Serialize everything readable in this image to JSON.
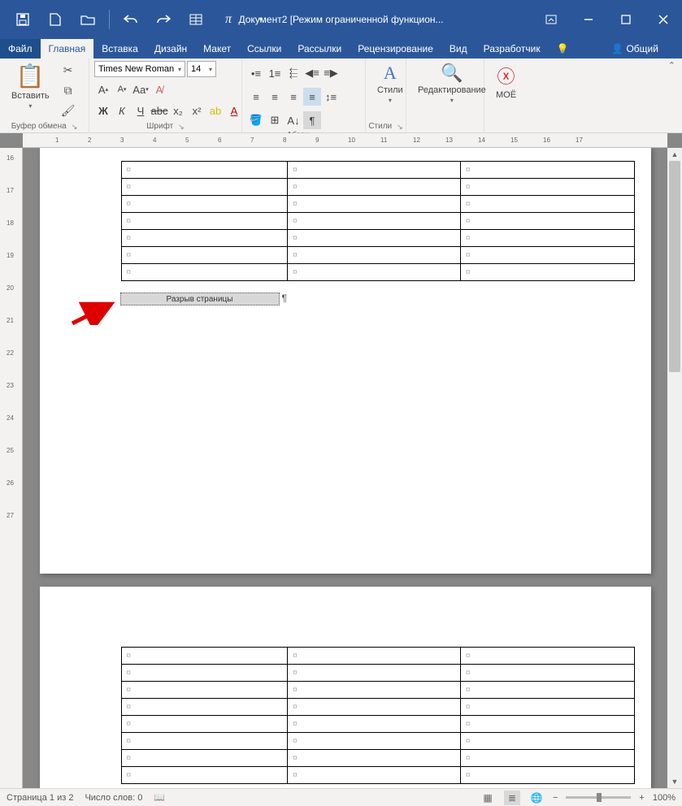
{
  "title": "Документ2 [Режим ограниченной функцион...",
  "qat": {
    "save": "save",
    "new": "new",
    "open": "open",
    "undo": "undo",
    "redo": "redo",
    "table": "table",
    "pi": "π",
    "tri": "▾"
  },
  "win": {
    "box": "box",
    "min": "—",
    "max": "❐",
    "close": "✕"
  },
  "tabs": {
    "file": "Файл",
    "home": "Главная",
    "insert": "Вставка",
    "design": "Дизайн",
    "layout": "Макет",
    "references": "Ссылки",
    "mailings": "Рассылки",
    "review": "Рецензирование",
    "view": "Вид",
    "developer": "Разработчик",
    "help": "Помощ",
    "share": "Общий доступ"
  },
  "ribbon": {
    "clipboard": {
      "paste": "Вставить",
      "label": "Буфер обмена"
    },
    "font": {
      "name": "Times New Roman",
      "size": "14",
      "label": "Шрифт",
      "bold": "Ж",
      "italic": "К",
      "underline": "Ч"
    },
    "paragraph": {
      "label": "Абзац"
    },
    "styles": {
      "btn": "Стили",
      "label": "Стили"
    },
    "editing": {
      "btn": "Редактирование"
    },
    "moe": {
      "btn": "МОЁ"
    }
  },
  "ruler_h": [
    1,
    2,
    3,
    4,
    5,
    6,
    7,
    8,
    9,
    10,
    11,
    12,
    13,
    14,
    15,
    16,
    17
  ],
  "ruler_v": [
    16,
    17,
    18,
    19,
    20,
    21,
    22,
    23,
    24,
    25,
    26,
    27
  ],
  "page_break_label": "Разрыв страницы",
  "cell_mark": "¤",
  "table1_rows": 7,
  "table2_rows": 8,
  "status": {
    "page": "Страница 1 из 2",
    "words": "Число слов: 0",
    "zoom": "100%"
  }
}
